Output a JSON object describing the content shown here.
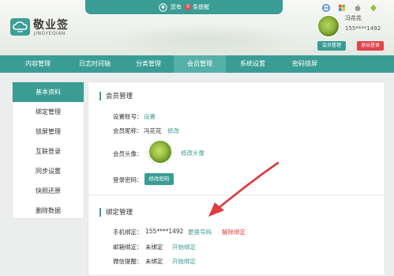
{
  "header": {
    "logo_title": "敬业签",
    "logo_sub": "JINGYEQIAN",
    "notify_text_pre": "您有",
    "notify_badge": "0",
    "notify_text_post": "条提醒",
    "user_name": "冯花花",
    "user_phone": "155****1492",
    "member_button": "会员管理",
    "logout_button": "退出登录"
  },
  "nav": [
    "内容管理",
    "日志时间轴",
    "分类管理",
    "会员管理",
    "系统设置",
    "密码锁屏"
  ],
  "sidebar": [
    "基本资料",
    "绑定管理",
    "锁屏管理",
    "互联登录",
    "同步设置",
    "快照还原",
    "删除数据"
  ],
  "member": {
    "title": "会员管理",
    "account_label": "设置账号：",
    "account_link": "设置",
    "nickname_label": "会员昵称：",
    "nickname_value": "冯花花",
    "nickname_link": "修改",
    "avatar_label": "会员头像：",
    "avatar_link": "修改头像",
    "password_label": "登录密码：",
    "password_button": "修改密码"
  },
  "binding": {
    "title": "绑定管理",
    "phone_label": "手机绑定：",
    "phone_value": "155****1492",
    "phone_change": "更换号码",
    "phone_unbind": "解除绑定",
    "email_label": "邮箱绑定：",
    "email_value": "未绑定",
    "email_link": "开始绑定",
    "wechat_label": "微信提醒：",
    "wechat_value": "未绑定",
    "wechat_link": "开始绑定"
  },
  "colors": {
    "accent": "#3a9d95",
    "danger": "#e0434b",
    "annotation": "#e0393e"
  }
}
